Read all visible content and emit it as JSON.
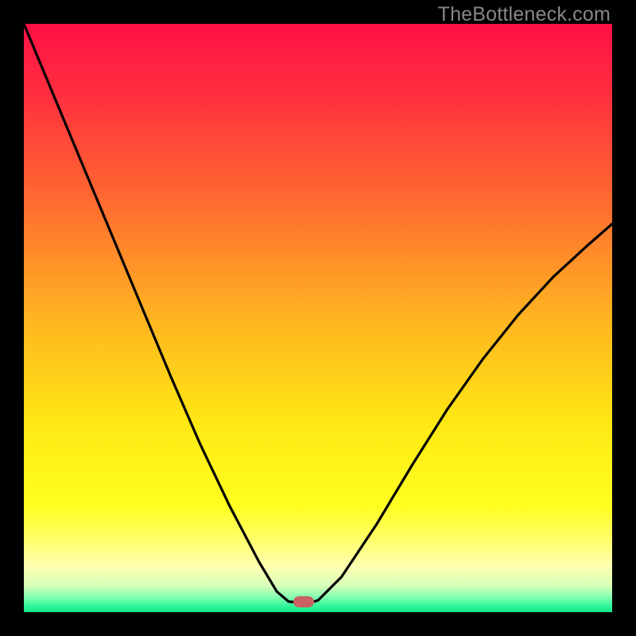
{
  "watermark": "TheBottleneck.com",
  "gradient_stops": [
    {
      "offset": 0.0,
      "color": "#ff1045"
    },
    {
      "offset": 0.12,
      "color": "#ff2f3f"
    },
    {
      "offset": 0.3,
      "color": "#ff6a30"
    },
    {
      "offset": 0.5,
      "color": "#ffb421"
    },
    {
      "offset": 0.68,
      "color": "#ffe814"
    },
    {
      "offset": 0.82,
      "color": "#ffff20"
    },
    {
      "offset": 0.88,
      "color": "#ffff70"
    },
    {
      "offset": 0.92,
      "color": "#ffffb0"
    },
    {
      "offset": 0.955,
      "color": "#d8ffb8"
    },
    {
      "offset": 0.975,
      "color": "#80ffb0"
    },
    {
      "offset": 0.99,
      "color": "#30f59a"
    },
    {
      "offset": 1.0,
      "color": "#10e888"
    }
  ],
  "marker": {
    "x_frac": 0.475,
    "y_frac": 0.983
  },
  "chart_data": {
    "type": "line",
    "title": "",
    "xlabel": "",
    "ylabel": "",
    "xlim": [
      0,
      1
    ],
    "ylim": [
      0,
      1
    ],
    "legend": false,
    "grid": false,
    "series": [
      {
        "name": "left-curve",
        "color": "#000000",
        "x": [
          0.0,
          0.05,
          0.1,
          0.15,
          0.2,
          0.25,
          0.3,
          0.35,
          0.4,
          0.43,
          0.45,
          0.46
        ],
        "y": [
          1.0,
          0.88,
          0.76,
          0.64,
          0.52,
          0.4,
          0.285,
          0.18,
          0.085,
          0.035,
          0.018,
          0.017
        ]
      },
      {
        "name": "right-curve",
        "color": "#000000",
        "x": [
          0.49,
          0.5,
          0.54,
          0.6,
          0.66,
          0.72,
          0.78,
          0.84,
          0.9,
          0.96,
          1.0
        ],
        "y": [
          0.017,
          0.02,
          0.06,
          0.15,
          0.25,
          0.345,
          0.43,
          0.505,
          0.57,
          0.625,
          0.66
        ]
      },
      {
        "name": "flat-bottom",
        "color": "#000000",
        "x": [
          0.46,
          0.49
        ],
        "y": [
          0.017,
          0.017
        ]
      }
    ],
    "annotations": [
      {
        "text": "TheBottleneck.com",
        "position": "top-right"
      }
    ],
    "marker": {
      "x": 0.475,
      "y": 0.017,
      "shape": "rounded-rect",
      "color": "#c8615f"
    }
  }
}
